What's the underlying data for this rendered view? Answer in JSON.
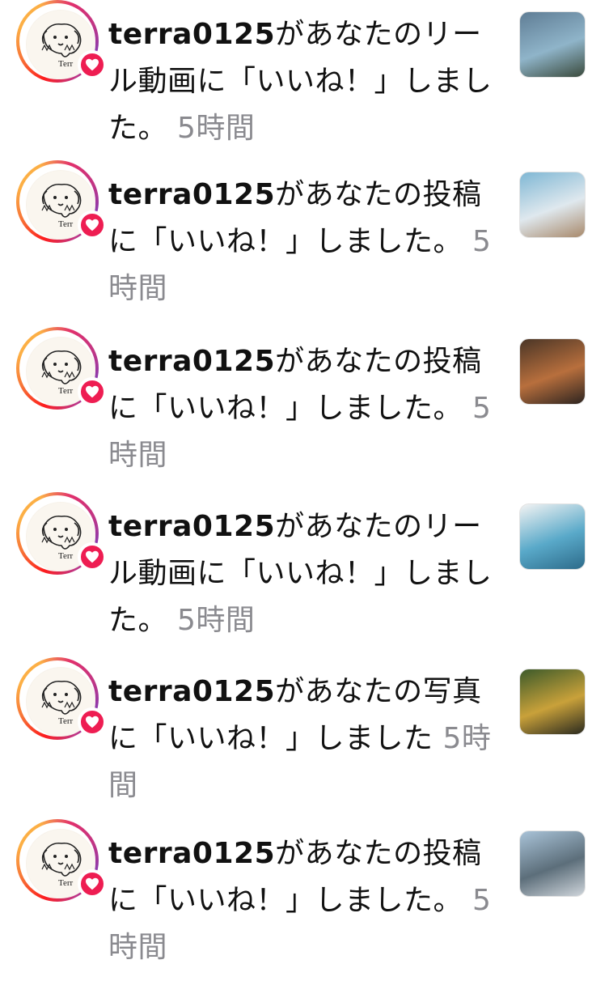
{
  "notifications": [
    {
      "username": "terra0125",
      "message": "があなたのリール動画に「いいね！」しました。",
      "time": "5時間",
      "avatar_text": "Terr",
      "thumb_colors": [
        "#5f7d95",
        "#8fb4c9",
        "#3a4a3c"
      ]
    },
    {
      "username": "terra0125",
      "message": "があなたの投稿に「いいね！」しました。",
      "time": "5時間",
      "avatar_text": "Terr",
      "thumb_colors": [
        "#7fb7d4",
        "#dfe8ee",
        "#a8896b"
      ]
    },
    {
      "username": "terra0125",
      "message": "があなたの投稿に「いいね！」しました。",
      "time": "5時間",
      "avatar_text": "Terr",
      "thumb_colors": [
        "#4a3526",
        "#b86f3d",
        "#2d2420"
      ]
    },
    {
      "username": "terra0125",
      "message": "があなたのリール動画に「いいね！」しました。",
      "time": "5時間",
      "avatar_text": "Terr",
      "thumb_colors": [
        "#f3f3f3",
        "#59a9c9",
        "#2d6b8a"
      ]
    },
    {
      "username": "terra0125",
      "message": "があなたの写真に「いいね！」しました",
      "time": "5時間",
      "avatar_text": "Terr",
      "thumb_colors": [
        "#3c5a2a",
        "#c9a13a",
        "#2a2a1f"
      ]
    },
    {
      "username": "terra0125",
      "message": "があなたの投稿に「いいね！」しました。",
      "time": "5時間",
      "avatar_text": "Terr",
      "thumb_colors": [
        "#a9c3d8",
        "#5c6e7a",
        "#cfd5db"
      ]
    }
  ],
  "colors": {
    "heart": "#ee1d52",
    "time": "#8a8a8f"
  },
  "icons": {
    "badge": "heart-icon"
  }
}
